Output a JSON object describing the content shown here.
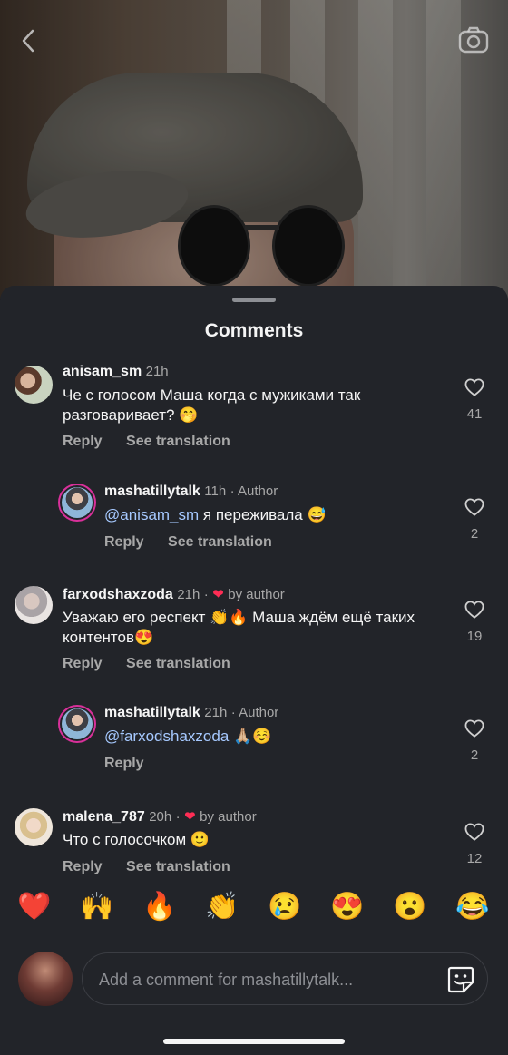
{
  "sheet": {
    "title": "Comments"
  },
  "comments": [
    {
      "username": "anisam_sm",
      "time": "21h",
      "byline": "",
      "text": "Че с голосом Маша когда с мужиками так разговаривает? 🤭",
      "reply": "Reply",
      "see_translation": "See translation",
      "likes": "41"
    },
    {
      "username": "mashatillytalk",
      "time": "11h",
      "byline": "· Author",
      "mention": "@anisam_sm",
      "text": " я переживала 😅",
      "reply": "Reply",
      "see_translation": "See translation",
      "likes": "2"
    },
    {
      "username": "farxodshaxzoda",
      "time": "21h",
      "byline": "by author",
      "liked_by_author": "·",
      "text": "Уважаю его респект 👏🔥 Маша  ждём ещё таких контентов😍",
      "reply": "Reply",
      "see_translation": "See translation",
      "likes": "19"
    },
    {
      "username": "mashatillytalk",
      "time": "21h",
      "byline": "· Author",
      "mention": "@farxodshaxzoda",
      "text": " 🙏🏼☺️",
      "reply": "Reply",
      "likes": "2"
    },
    {
      "username": "malena_787",
      "time": "20h",
      "byline": "by author",
      "liked_by_author": "·",
      "text": "Что с голосочком 🙂",
      "reply": "Reply",
      "see_translation": "See translation",
      "likes": "12"
    }
  ],
  "emoji_bar": [
    "❤️",
    "🙌",
    "🔥",
    "👏",
    "😢",
    "😍",
    "😮",
    "😂"
  ],
  "composer": {
    "placeholder": "Add a comment for mashatillytalk..."
  }
}
